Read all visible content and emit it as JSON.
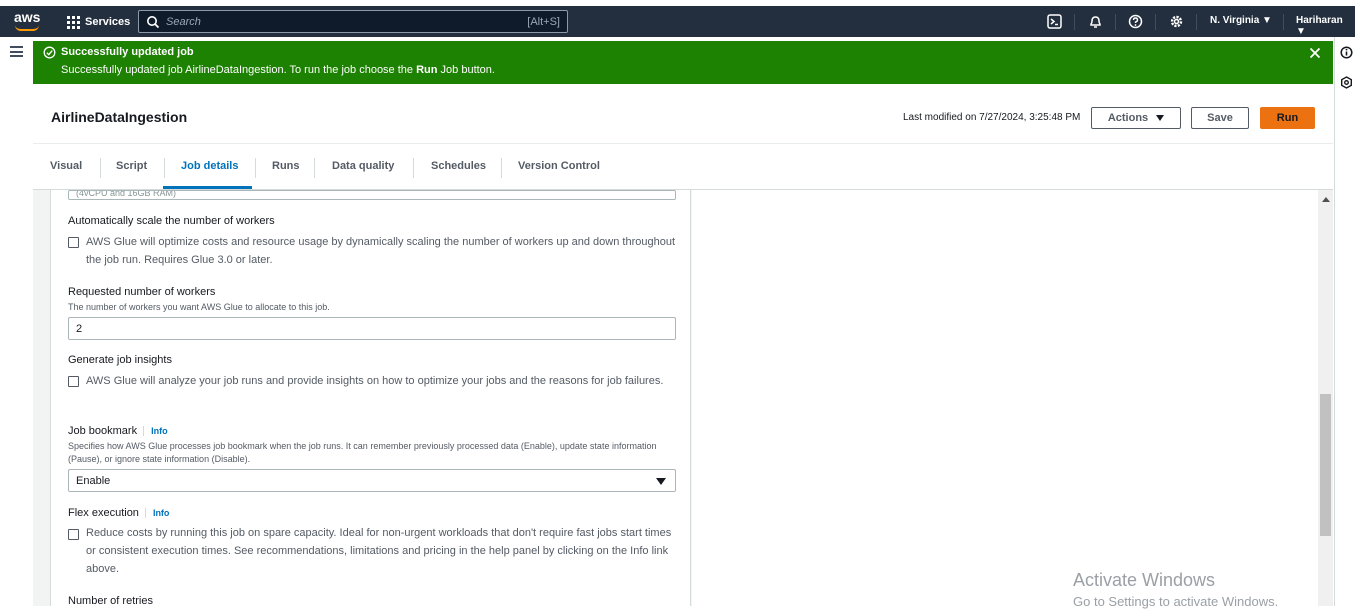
{
  "navbar": {
    "logo_text": "aws",
    "services_label": "Services",
    "search_placeholder": "Search",
    "search_shortcut": "[Alt+S]",
    "region": "N. Virginia ▼",
    "user": "Hariharan ▼"
  },
  "flash": {
    "title": "Successfully updated job",
    "message_prefix": "Successfully updated job AirlineDataIngestion. To run the job choose the ",
    "message_bold": "Run",
    "message_suffix": " Job button.",
    "color": "#1d8102"
  },
  "header": {
    "job_name": "AirlineDataIngestion",
    "last_modified": "Last modified on 7/27/2024, 3:25:48 PM",
    "actions_label": "Actions",
    "save_label": "Save",
    "run_label": "Run",
    "accent": "#ec7211"
  },
  "tabs": [
    {
      "label": "Visual"
    },
    {
      "label": "Script"
    },
    {
      "label": "Job details",
      "active": true
    },
    {
      "label": "Runs"
    },
    {
      "label": "Data quality"
    },
    {
      "label": "Schedules"
    },
    {
      "label": "Version Control"
    }
  ],
  "form": {
    "clipped_input_text": "(4vCPU and 16GB RAM)",
    "autoscale": {
      "label": "Automatically scale the number of workers",
      "checkbox_text": "AWS Glue will optimize costs and resource usage by dynamically scaling the number of workers up and down throughout the job run. Requires Glue 3.0 or later.",
      "checked": false
    },
    "workers": {
      "label": "Requested number of workers",
      "description": "The number of workers you want AWS Glue to allocate to this job.",
      "value": "2"
    },
    "insights": {
      "label": "Generate job insights",
      "checkbox_text": "AWS Glue will analyze your job runs and provide insights on how to optimize your jobs and the reasons for job failures.",
      "checked": false
    },
    "bookmark": {
      "label": "Job bookmark",
      "info": "Info",
      "description": "Specifies how AWS Glue processes job bookmark when the job runs. It can remember previously processed data (Enable), update state information (Pause), or ignore state information (Disable).",
      "value": "Enable"
    },
    "flex": {
      "label": "Flex execution",
      "info": "Info",
      "checkbox_text": "Reduce costs by running this job on spare capacity. Ideal for non-urgent workloads that don't require fast jobs start times or consistent execution times. See recommendations, limitations and pricing in the help panel by clicking on the Info link above.",
      "checked": false
    },
    "retries": {
      "label": "Number of retries"
    }
  },
  "watermark": {
    "line1": "Activate Windows",
    "line2": "Go to Settings to activate Windows."
  }
}
